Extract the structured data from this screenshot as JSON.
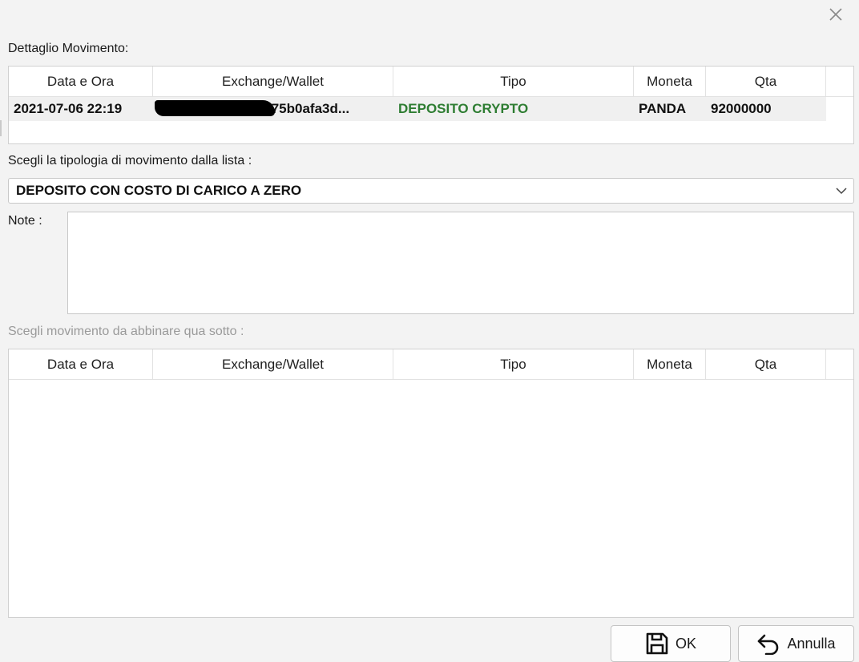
{
  "dialog": {
    "detail_label": "Dettaglio Movimento:",
    "type_label": "Scegli la tipologia di movimento dalla lista :",
    "note_label": "Note :",
    "match_label": "Scegli movimento da abbinare qua sotto :"
  },
  "columns": [
    "Data e Ora",
    "Exchange/Wallet",
    "Tipo",
    "Moneta",
    "Qta"
  ],
  "detail_row": {
    "datetime": "2021-07-06 22:19",
    "wallet": "0x……………004675b0afa3d...",
    "type": "DEPOSITO CRYPTO",
    "coin": "PANDA",
    "qty": "92000000"
  },
  "type_select": {
    "value": "DEPOSITO CON COSTO DI CARICO A ZERO"
  },
  "notes": {
    "value": ""
  },
  "buttons": {
    "ok": "OK",
    "cancel": "Annulla"
  },
  "colors": {
    "type_green": "#2e7d32"
  },
  "icons": {
    "close": "close-icon",
    "dropdown": "chevron-down-icon",
    "ok": "save-icon",
    "cancel": "undo-icon"
  }
}
